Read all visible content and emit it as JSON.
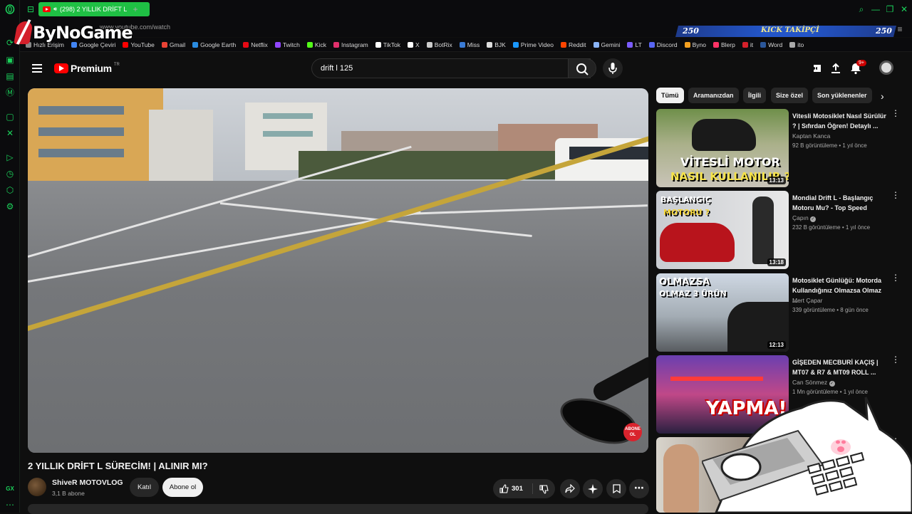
{
  "browser": {
    "tab_title": "(298) 2 YILLIK DRİFT L",
    "url": "www.youtube.com/watch",
    "bookmarks": [
      {
        "label": "Hızlı Erişim",
        "color": "#888888"
      },
      {
        "label": "Google Çeviri",
        "color": "#4285f4"
      },
      {
        "label": "YouTube",
        "color": "#ff0000"
      },
      {
        "label": "Gmail",
        "color": "#ea4335"
      },
      {
        "label": "Google Earth",
        "color": "#2a8be0"
      },
      {
        "label": "Netflix",
        "color": "#e50914"
      },
      {
        "label": "Twitch",
        "color": "#9146ff"
      },
      {
        "label": "Kick",
        "color": "#53fc18"
      },
      {
        "label": "Instagram",
        "color": "#e1306c"
      },
      {
        "label": "TikTok",
        "color": "#ffffff"
      },
      {
        "label": "X",
        "color": "#ffffff"
      },
      {
        "label": "BotRix",
        "color": "#cccccc"
      },
      {
        "label": "Miss",
        "color": "#3a7bd5"
      },
      {
        "label": "BJK",
        "color": "#dddddd"
      },
      {
        "label": "Prime Video",
        "color": "#1a98ff"
      },
      {
        "label": "Reddit",
        "color": "#ff4500"
      },
      {
        "label": "Gemini",
        "color": "#8ab4f8"
      },
      {
        "label": "LT",
        "color": "#7b5cff"
      },
      {
        "label": "Discord",
        "color": "#5865f2"
      },
      {
        "label": "Byno",
        "color": "#f4a020"
      },
      {
        "label": "Blerp",
        "color": "#ff3366"
      },
      {
        "label": "it",
        "color": "#d4202b"
      },
      {
        "label": "Word",
        "color": "#2b579a"
      },
      {
        "label": "ito",
        "color": "#aaaaaa"
      }
    ]
  },
  "overlay": {
    "logo_text": "ByNoGame",
    "kick_count_left": "250",
    "kick_label": "KICK TAKİPÇİ",
    "kick_count_right": "250"
  },
  "youtube": {
    "logo_label": "Premium",
    "logo_country": "TR",
    "search_query": "drift l 125",
    "notification_count": "9+",
    "video": {
      "title": "2 YILLIK DRİFT L SÜRECİM! | ALINIR MI?",
      "channel": "ShiveR MOTOVLOG",
      "subscribers": "3,1 B abone",
      "join_label": "Katıl",
      "subscribe_label": "Abone ol",
      "likes": "301",
      "player_badge": "ABONE OL"
    },
    "chips": [
      "Tümü",
      "Aramanızdan",
      "İlgili",
      "Size özel",
      "Son yüklenenler"
    ],
    "recommendations": [
      {
        "title": "Vitesli Motosiklet Nasıl Sürülür ? | Sıfırdan Öğren! Detaylı ...",
        "channel": "Kaptan Kanca",
        "meta": "92 B görüntüleme • 1 yıl önce",
        "duration": "13:13",
        "thumb_text": "VİTESLİ MOTOR NASIL KULLANILIR ?"
      },
      {
        "title": "Mondial Drift L - Başlangıç Motoru Mu? - Top Speed",
        "channel": "Çapın",
        "meta": "232 B görüntüleme • 1 yıl önce",
        "duration": "13:18",
        "thumb_text_1": "BAŞLANGIÇ",
        "thumb_text_2": "MOTORU ?"
      },
      {
        "title": "Motosiklet Günlüğü: Motorda Kullandığınız Olmazsa Olmaz ...",
        "channel": "Mert Çapar",
        "meta": "339 görüntüleme • 8 gün önce",
        "duration": "12:13",
        "thumb_text_1": "OLMAZSA",
        "thumb_text_2": "OLMAZ 3 ÜRÜN"
      },
      {
        "title": "GİŞEDEN MECBURİ KAÇIŞ | MT07 & R7 & MT09 ROLL ...",
        "channel": "Can Sönmez",
        "meta": "1 Mn görüntüleme • 1 yıl önce",
        "duration": "",
        "thumb_text": "YAPMA!"
      }
    ]
  }
}
